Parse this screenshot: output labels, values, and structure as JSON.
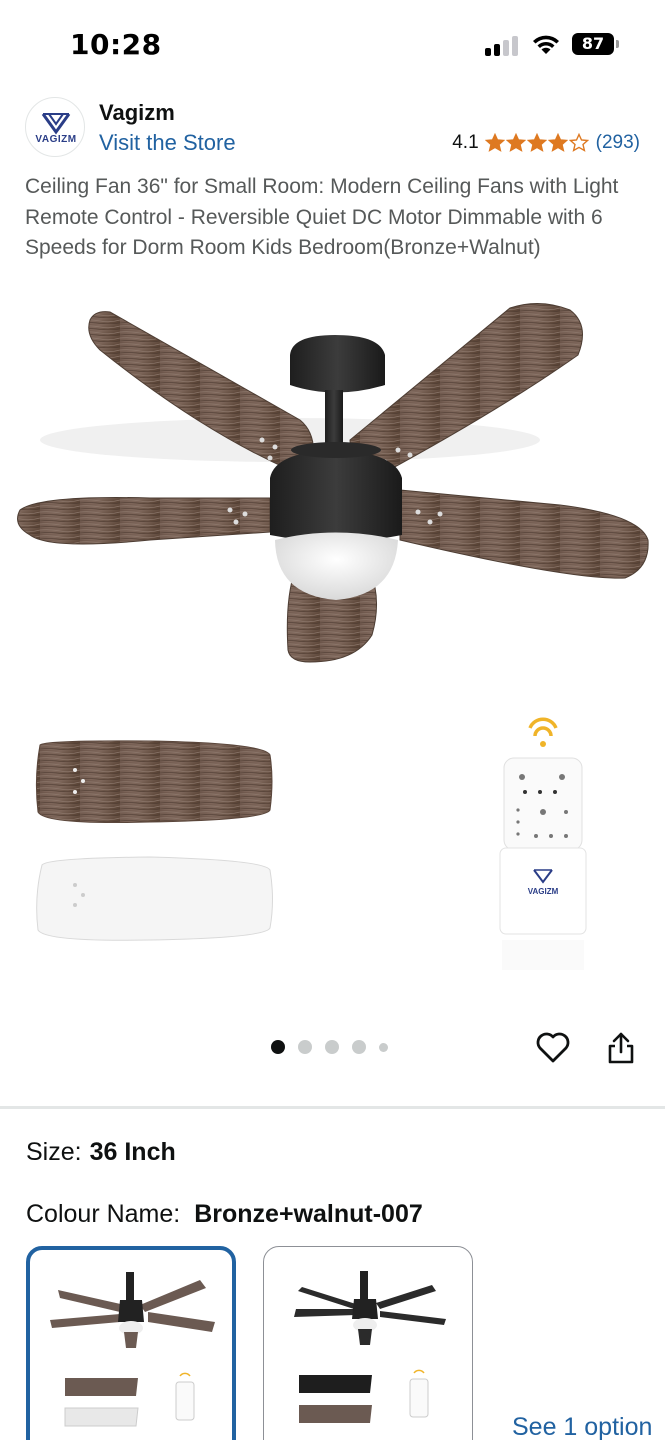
{
  "status_bar": {
    "time": "10:28",
    "battery": "87",
    "icons": [
      "cellular-signal-icon",
      "wifi-icon",
      "battery-icon"
    ]
  },
  "store": {
    "logo_text": "VAGIZM",
    "brand_name": "Vagizm",
    "visit_store": "Visit the Store",
    "rating": "4.1",
    "rating_stars": 4.1,
    "rating_count": "(293)"
  },
  "product": {
    "title": "Ceiling Fan 36\" for Small Room: Modern Ceiling Fans with Light Remote Control - Reversible Quiet DC Motor Dimmable with 6 Speeds for Dorm Room Kids Bedroom(Bronze+Walnut)",
    "remote_logo_text": "VAGIZM"
  },
  "carousel": {
    "total_images": 5,
    "active_index": 0
  },
  "actions": {
    "favorite_icon": "heart-icon",
    "share_icon": "share-icon"
  },
  "variations": {
    "size_label": "Size:",
    "size_value": "36 Inch",
    "colour_label": "Colour Name:",
    "colour_value": "Bronze+walnut-007",
    "swatches": [
      {
        "name": "Bronze+walnut-007",
        "selected": true
      },
      {
        "name": "Black",
        "selected": false
      }
    ],
    "see_options": "See 1 option"
  },
  "colors": {
    "link": "#2162a1",
    "star": "#de7921",
    "selected_border": "#2162a1",
    "text": "#0f1111",
    "muted_text": "#565959"
  }
}
